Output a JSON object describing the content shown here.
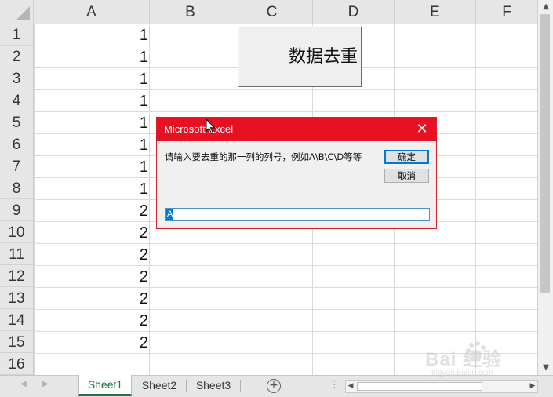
{
  "columns": [
    "A",
    "B",
    "C",
    "D",
    "E",
    "F"
  ],
  "rows": [
    "1",
    "2",
    "3",
    "4",
    "5",
    "6",
    "7",
    "8",
    "9",
    "10",
    "11",
    "12",
    "13",
    "14",
    "15",
    "16"
  ],
  "column_a_values": [
    "1",
    "1",
    "1",
    "1",
    "1",
    "1",
    "1",
    "1",
    "2",
    "2",
    "2",
    "2",
    "2",
    "2",
    "2",
    ""
  ],
  "macro_button": {
    "label": "数据去重"
  },
  "dialog": {
    "title": "Microsoft Excel",
    "close_symbol": "✕",
    "prompt": "请输入要去重的那一列的列号，例如A\\B\\C\\D等等",
    "ok_label": "确定",
    "cancel_label": "取消",
    "input_value": "A"
  },
  "sheets": {
    "tabs": [
      "Sheet1",
      "Sheet2",
      "Sheet3"
    ],
    "active": "Sheet1",
    "add_symbol": "+"
  },
  "watermark": {
    "text": "Bai 经验",
    "sub": "jingyan.baidu.com"
  },
  "colors": {
    "dialog_title_bar": "#e81123",
    "active_tab": "#217346",
    "selection": "#0078d7"
  }
}
